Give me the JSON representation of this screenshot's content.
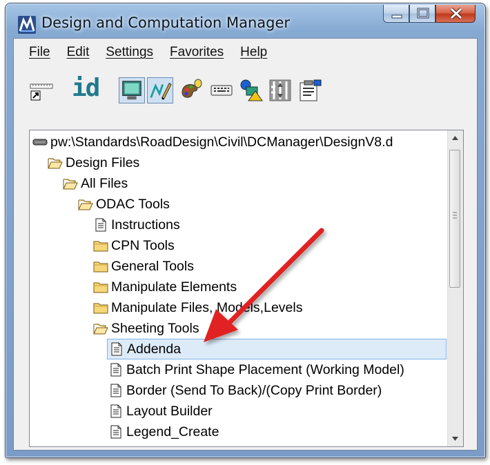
{
  "window": {
    "title": "Design and Computation Manager",
    "icon": "microstation-logo-icon"
  },
  "caption_buttons": [
    "minimize",
    "maximize",
    "close"
  ],
  "menu": {
    "items": [
      "File",
      "Edit",
      "Settings",
      "Favorites",
      "Help"
    ]
  },
  "toolbar": {
    "id_label": "id",
    "buttons": [
      "ruler-shortcut-icon",
      "id-label",
      "monitor-icon",
      "pen-drawing-icon",
      "palette-icon",
      "keyboard-icon",
      "shapes-icon",
      "level-icon",
      "clipboard-icon"
    ],
    "selected": [
      "monitor-icon",
      "pen-drawing-icon"
    ]
  },
  "tree": {
    "items": [
      {
        "label": "pw:\\Standards\\RoadDesign\\Civil\\DCManager\\DesignV8.d",
        "icon": "drive-icon",
        "level": 0
      },
      {
        "label": "Design Files",
        "icon": "folder-open-icon",
        "level": 1
      },
      {
        "label": "All Files",
        "icon": "folder-open-icon",
        "level": 2
      },
      {
        "label": "ODAC Tools",
        "icon": "folder-open-icon",
        "level": 3
      },
      {
        "label": "Instructions",
        "icon": "document-icon",
        "level": 4
      },
      {
        "label": "CPN Tools",
        "icon": "folder-icon",
        "level": 4
      },
      {
        "label": "General Tools",
        "icon": "folder-icon",
        "level": 4
      },
      {
        "label": "Manipulate Elements",
        "icon": "folder-icon",
        "level": 4
      },
      {
        "label": "Manipulate Files, Models,Levels",
        "icon": "folder-icon",
        "level": 4
      },
      {
        "label": "Sheeting Tools",
        "icon": "folder-open-icon",
        "level": 4
      },
      {
        "label": "Addenda",
        "icon": "document-icon",
        "level": 5,
        "selected": true
      },
      {
        "label": "Batch Print Shape Placement (Working Model)",
        "icon": "document-icon",
        "level": 5
      },
      {
        "label": "Border (Send To Back)/(Copy Print Border)",
        "icon": "document-icon",
        "level": 5
      },
      {
        "label": "Layout Builder",
        "icon": "document-icon",
        "level": 5
      },
      {
        "label": "Legend_Create",
        "icon": "document-icon",
        "level": 5
      }
    ]
  },
  "annotation": {
    "type": "arrow",
    "color": "#e02020",
    "points_to": "Addenda"
  },
  "colors": {
    "selection_bg": "#ddebf8",
    "selection_border": "#7fb2e6",
    "arrow": "#e02020"
  }
}
